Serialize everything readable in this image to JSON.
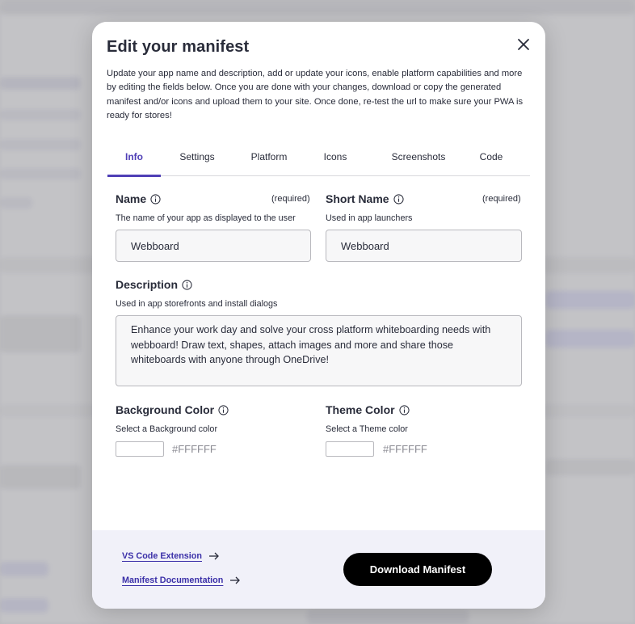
{
  "modal": {
    "title": "Edit your manifest",
    "intro": "Update your app name and description, add or update your icons, enable platform capabilities and more by editing the fields below. Once you are done with your changes, download or copy the generated manifest and/or icons and upload them to your site. Once done, re-test the url to make sure your PWA is ready for stores!",
    "close_icon": "close-icon"
  },
  "tabs": [
    {
      "label": "Info",
      "active": true
    },
    {
      "label": "Settings",
      "active": false
    },
    {
      "label": "Platform",
      "active": false
    },
    {
      "label": "Icons",
      "active": false
    },
    {
      "label": "Screenshots",
      "active": false
    },
    {
      "label": "Code",
      "active": false
    }
  ],
  "fields": {
    "name": {
      "label": "Name",
      "required": "(required)",
      "hint": "The name of your app as displayed to the user",
      "value": "Webboard"
    },
    "short_name": {
      "label": "Short Name",
      "required": "(required)",
      "hint": "Used in app launchers",
      "value": "Webboard"
    },
    "description": {
      "label": "Description",
      "hint": "Used in app storefronts and install dialogs",
      "value": "Enhance your work day and solve your cross platform whiteboarding needs with webboard! Draw text, shapes, attach images and more and share those whiteboards with anyone through OneDrive!"
    },
    "background_color": {
      "label": "Background Color",
      "hint": "Select a Background color",
      "value": "#FFFFFF"
    },
    "theme_color": {
      "label": "Theme Color",
      "hint": "Select a Theme color",
      "value": "#FFFFFF"
    }
  },
  "footer": {
    "vscode_link": "VS Code Extension",
    "docs_link": "Manifest Documentation",
    "download_button": "Download Manifest"
  },
  "colors": {
    "accent": "#4f3fb6",
    "link": "#3a2fa8",
    "text": "#292c3a",
    "footer_bg": "#f1f1f9",
    "button_bg": "#000000"
  }
}
